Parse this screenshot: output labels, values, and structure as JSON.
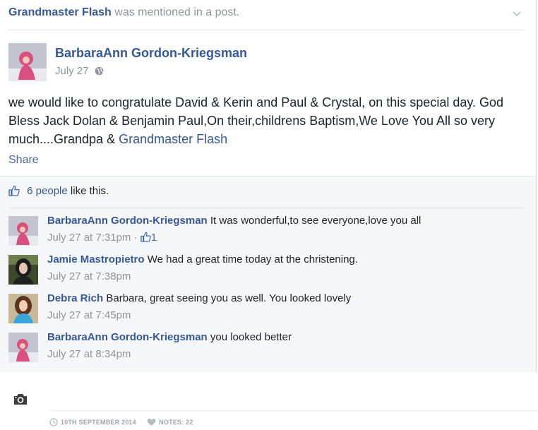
{
  "notification": {
    "mentioned_name": "Grandmaster Flash",
    "mentioned_text": "was mentioned in a post."
  },
  "post": {
    "author": "BarbaraAnn Gordon-Kriegsman",
    "date": "July 27",
    "privacy_icon": "globe-icon",
    "text": "we would like to congratulate David & Kerin and Paul & Crystal, on this special day. God Bless Jack Dolan & Benjamin Paul,On their,childrens Baptism,We Love You All so very much....Grandpa & ",
    "text_tag": "Grandmaster Flash",
    "share_label": "Share"
  },
  "likes": {
    "count_text": "6 people",
    "suffix": "like this."
  },
  "comments": [
    {
      "name": "BarbaraAnn Gordon-Kriegsman",
      "text": "It was wonderful,to see everyone,love you all",
      "time": "July 27 at 7:31pm",
      "separator": "·",
      "like_count": "1"
    },
    {
      "name": "Jamie Mastropietro",
      "text": "We had a great time today at the christening.",
      "time": "July 27 at 7:38pm"
    },
    {
      "name": "Debra Rich",
      "text": "Barbara, great seeing you as well. You looked lovely",
      "time": "July 27 at 7:45pm"
    },
    {
      "name": "BarbaraAnn Gordon-Kriegsman",
      "text": "you looked better",
      "time": "July 27 at 8:34pm"
    }
  ],
  "footer": {
    "date": "10TH SEPTEMBER 2014",
    "notes": "NOTES: 22"
  },
  "colors": {
    "link": "#365899",
    "meta": "#90949c",
    "ufi_background": "#f6f7f9"
  }
}
